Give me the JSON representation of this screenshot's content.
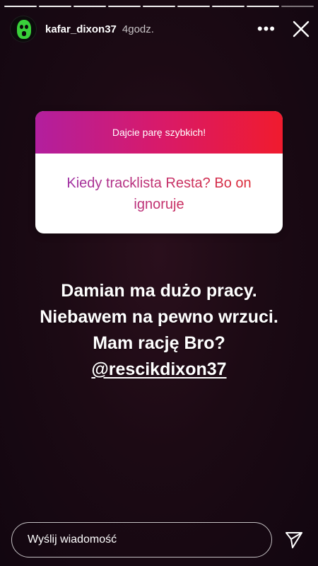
{
  "story": {
    "progress": {
      "segments": 9,
      "completed": 8
    },
    "author": {
      "username": "kafar_dixon37",
      "time_ago": "4godz."
    },
    "more_label": "•••"
  },
  "question_sticker": {
    "prompt": "Dajcie parę szybkich!",
    "answer": "Kiedy tracklista Resta? Bo on ignoruje"
  },
  "caption": {
    "lines": [
      "Damian ma dużo pracy.",
      "Niebawem na pewno wrzuci.",
      "Mam rację Bro?"
    ],
    "mention": "@rescikdixon37"
  },
  "reply": {
    "placeholder": "Wyślij wiadomość"
  },
  "colors": {
    "gradient_start": "#b21f9e",
    "gradient_end": "#f01b2e",
    "background": "#1c0a14"
  },
  "icons": {
    "more": "more-dots-icon",
    "close": "close-icon",
    "send": "send-paper-plane-icon"
  }
}
